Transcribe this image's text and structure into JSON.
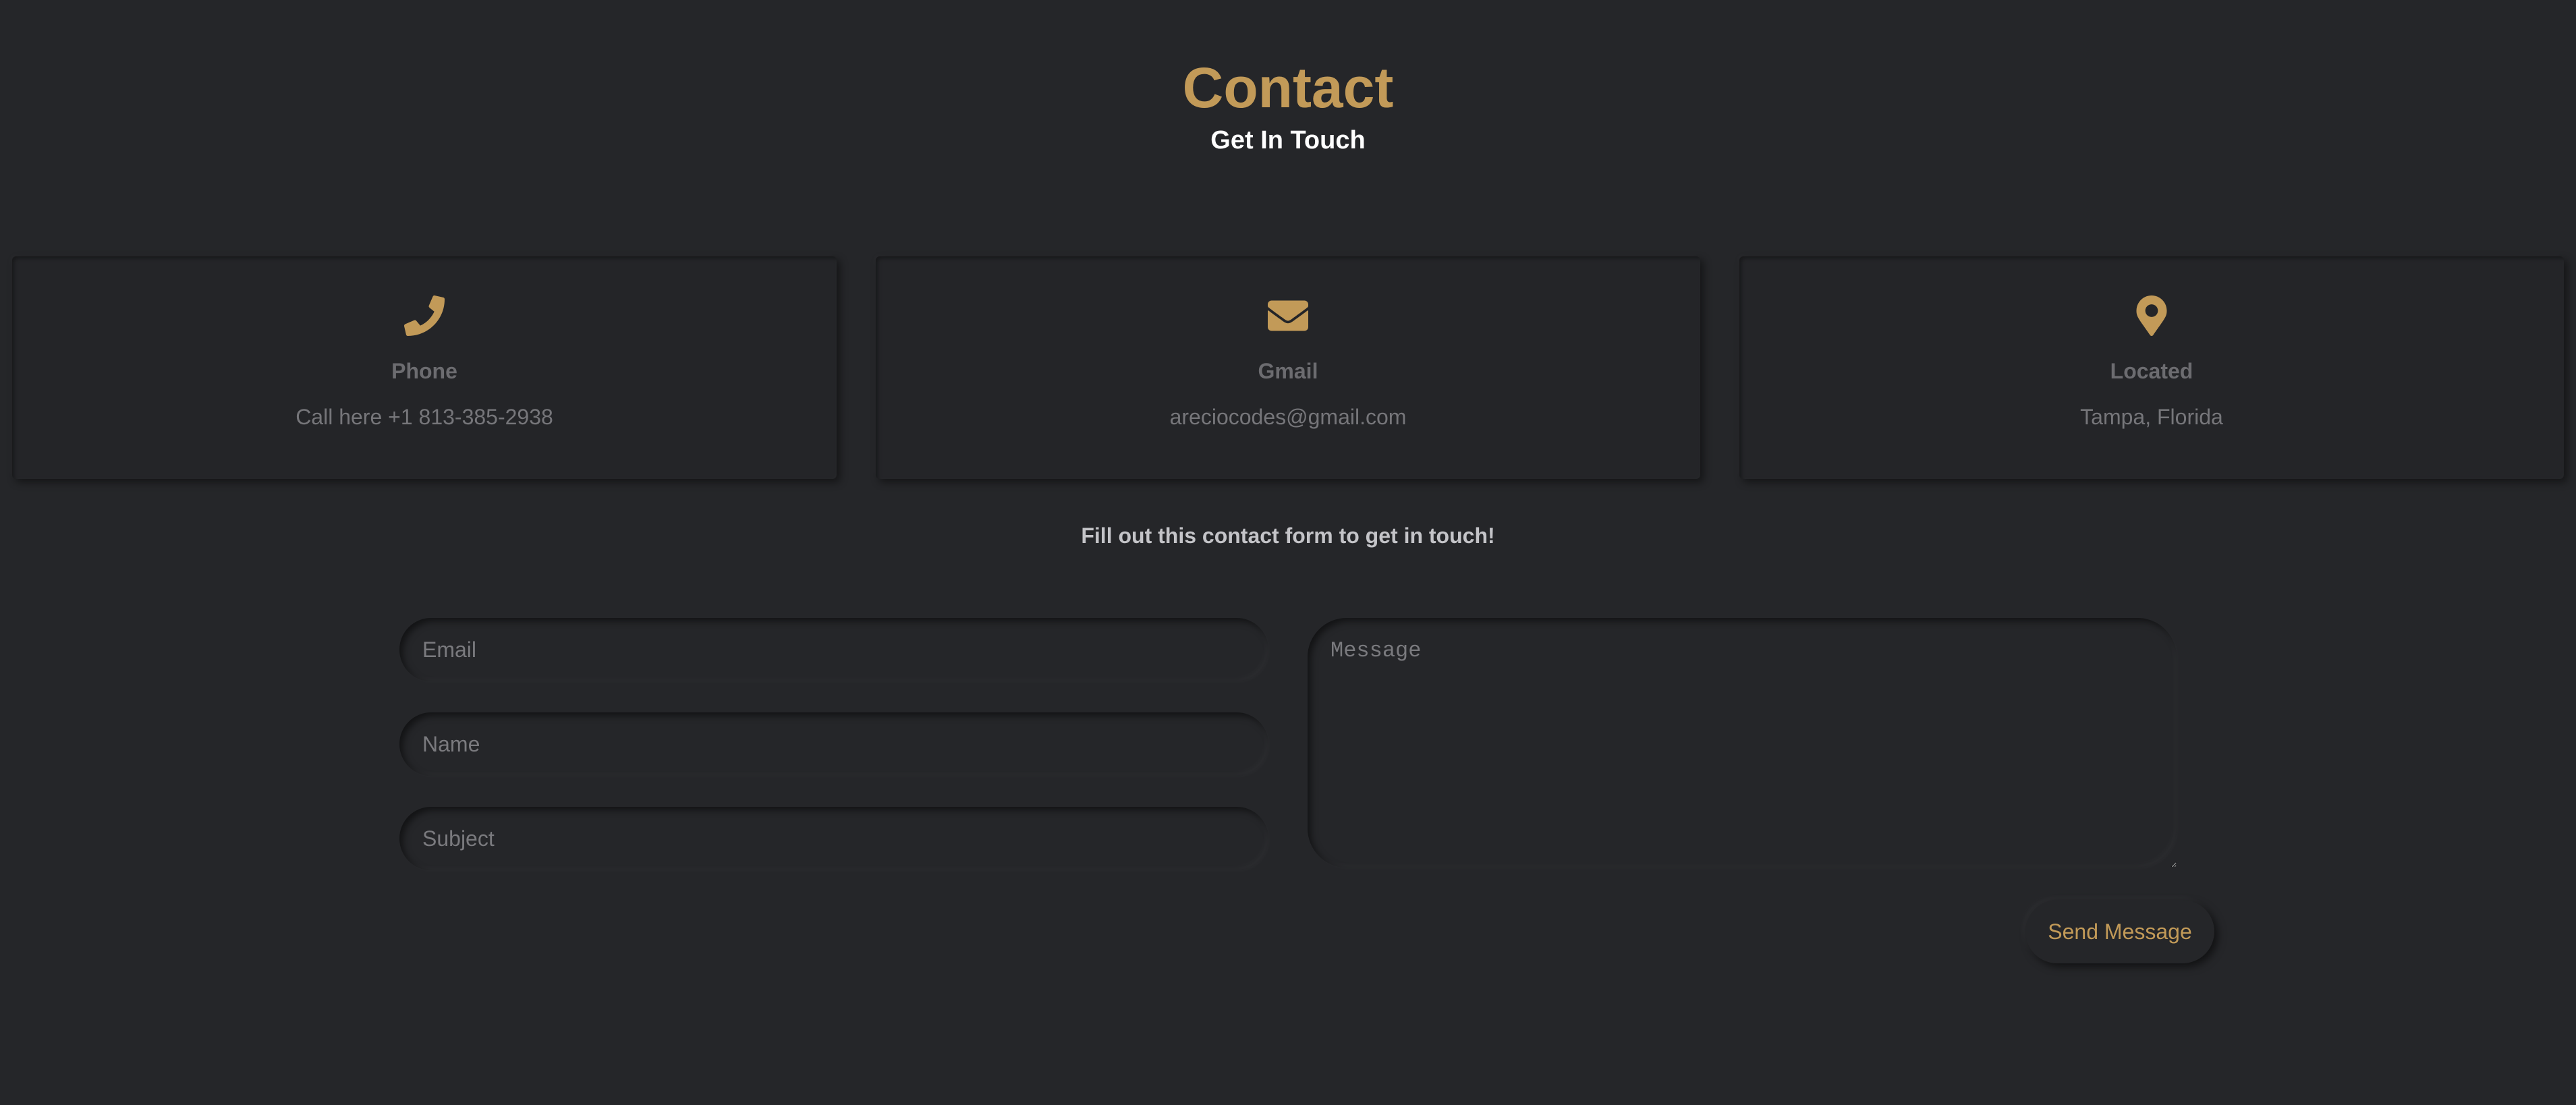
{
  "header": {
    "title": "Contact",
    "subtitle": "Get In Touch"
  },
  "cards": [
    {
      "icon": "phone-icon",
      "label": "Phone",
      "value": "Call here +1 813-385-2938"
    },
    {
      "icon": "envelope-icon",
      "label": "Gmail",
      "value": "areciocodes@gmail.com"
    },
    {
      "icon": "map-pin-icon",
      "label": "Located",
      "value": "Tampa, Florida"
    }
  ],
  "form": {
    "intro": "Fill out this contact form to get in touch!",
    "email_placeholder": "Email",
    "name_placeholder": "Name",
    "subject_placeholder": "Subject",
    "message_placeholder": "Message",
    "submit_label": "Send Message"
  },
  "colors": {
    "background": "#252629",
    "accent": "#c29a58",
    "heading": "#ffffff"
  }
}
